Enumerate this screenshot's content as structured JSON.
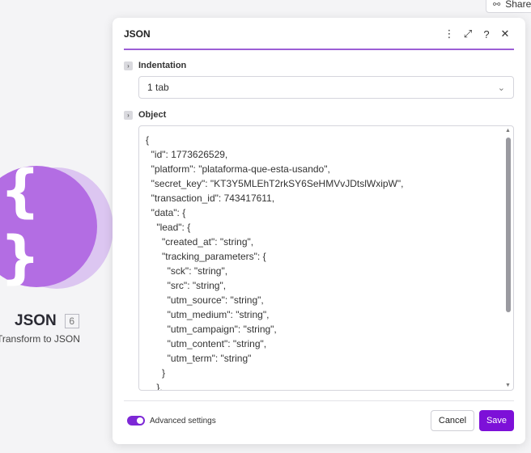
{
  "background": {
    "share_label": "Share",
    "module": {
      "name": "JSON",
      "badge": "6",
      "subtitle": "Transform to JSON",
      "color": "#b36de3"
    }
  },
  "dialog": {
    "title": "JSON",
    "header_icons": [
      "more-vertical-icon",
      "expand-icon",
      "help-icon",
      "close-icon"
    ],
    "accent_color": "#9c5ed6",
    "indentation": {
      "label": "Indentation",
      "value": "1 tab"
    },
    "object": {
      "label": "Object",
      "lines": [
        "{",
        "  \"id\": 1773626529,",
        "  \"platform\": \"plataforma-que-esta-usando\",",
        "  \"secret_key\": \"KT3Y5MLEhT2rkSY6SeHMVvJDtslWxipW\",",
        "  \"transaction_id\": 743417611,",
        "  \"data\": {",
        "    \"lead\": {",
        "      \"created_at\": \"string\",",
        "      \"tracking_parameters\": {",
        "        \"sck\": \"string\",",
        "        \"src\": \"string\",",
        "        \"utm_source\": \"string\",",
        "        \"utm_medium\": \"string\",",
        "        \"utm_campaign\": \"string\",",
        "        \"utm_content\": \"string\",",
        "        \"utm_term\": \"string\"",
        "      }",
        "    },"
      ]
    },
    "footer": {
      "advanced_settings_label": "Advanced settings",
      "advanced_settings_on": true,
      "cancel_label": "Cancel",
      "save_label": "Save",
      "save_color": "#7d10d8"
    }
  }
}
